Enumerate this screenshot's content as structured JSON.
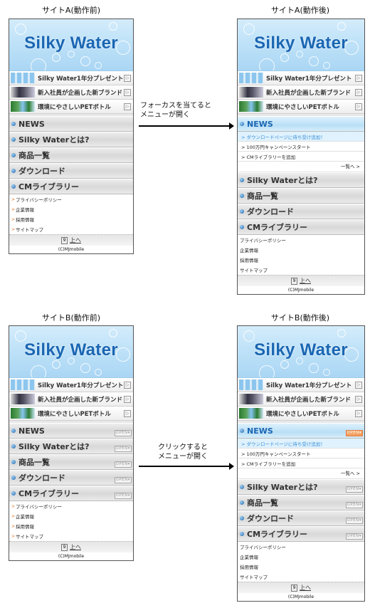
{
  "captions": {
    "a_before": "サイトA(動作前)",
    "a_after": "サイトA(動作後)",
    "b_before": "サイトB(動作前)",
    "b_after": "サイトB(動作後)"
  },
  "annotations": {
    "a_line1": "フォーカスを当てると",
    "a_line2": "メニューが開く",
    "b_line1": "クリックすると",
    "b_line2": "メニューが開く"
  },
  "site": {
    "title": "Silky Water",
    "promos": [
      {
        "label": "Silky Water1年分プレゼント",
        "arrow": "▷"
      },
      {
        "label": "新入社員が企画した新ブランド",
        "arrow": "▷"
      },
      {
        "label": "環境にやさしいPETボトル",
        "arrow": "▷"
      }
    ],
    "menus": [
      "NEWS",
      "Silky Waterとは?",
      "商品一覧",
      "ダウンロード",
      "CMライブラリー"
    ],
    "news_items": [
      "> ダウンロードページに待ち受け追加！",
      "> 100万円キャンペーンスタート",
      "> CMライブラリーを追加"
    ],
    "news_more": "一覧へ >",
    "links": [
      "プライバシーポリシー",
      "企業情報",
      "採用情報",
      "サイトマップ"
    ],
    "link_marker": ">",
    "open_label": "OPEN▾",
    "footer_key": "9",
    "footer_top": "上へ",
    "copyright": "(C)MJmobile"
  },
  "colors": {
    "brand": "#1a66b3",
    "highlight": "#3b8fd8",
    "open_active": "#f4a060"
  }
}
